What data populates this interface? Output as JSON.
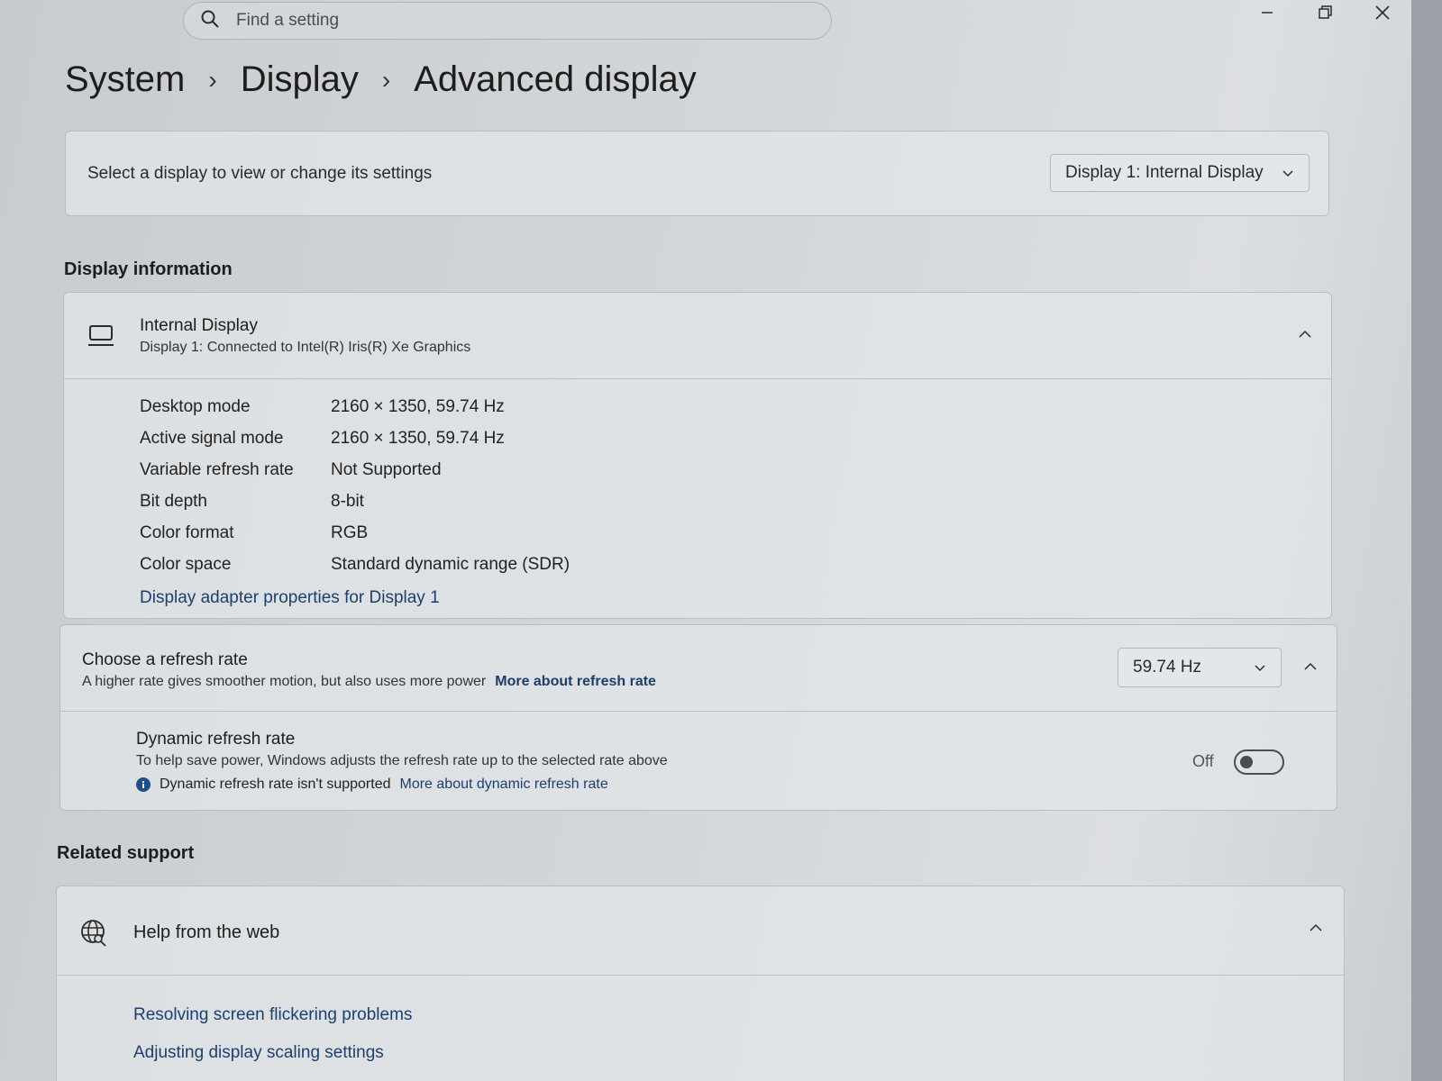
{
  "titlebar": {
    "search_placeholder": "Find a setting",
    "icons": [
      "search-icon",
      "minimize-icon",
      "restore-icon",
      "close-icon"
    ]
  },
  "breadcrumb": [
    "System",
    "Display",
    "Advanced display"
  ],
  "display_select": {
    "label": "Select a display to view or change its settings",
    "selected": "Display 1: Internal Display"
  },
  "display_information": {
    "heading": "Display information",
    "title": "Internal Display",
    "subtitle": "Display 1: Connected to Intel(R) Iris(R) Xe Graphics",
    "rows": [
      {
        "key": "Desktop mode",
        "value": "2160 × 1350, 59.74 Hz"
      },
      {
        "key": "Active signal mode",
        "value": "2160 × 1350, 59.74 Hz"
      },
      {
        "key": "Variable refresh rate",
        "value": "Not Supported"
      },
      {
        "key": "Bit depth",
        "value": "8-bit"
      },
      {
        "key": "Color format",
        "value": "RGB"
      },
      {
        "key": "Color space",
        "value": "Standard dynamic range (SDR)"
      }
    ],
    "adapter_link": "Display adapter properties for Display 1"
  },
  "refresh_rate": {
    "title": "Choose a refresh rate",
    "description": "A higher rate gives smoother motion, but also uses more power",
    "link": "More about refresh rate",
    "selected": "59.74 Hz"
  },
  "dynamic_refresh": {
    "title": "Dynamic refresh rate",
    "description": "To help save power, Windows adjusts the refresh rate up to the selected rate above",
    "info": "Dynamic refresh rate isn't supported",
    "link": "More about dynamic refresh rate",
    "toggle_label": "Off",
    "toggle_on": false
  },
  "related_support": {
    "heading": "Related support",
    "help_title": "Help from the web",
    "links": [
      "Resolving screen flickering problems",
      "Adjusting display scaling settings"
    ]
  }
}
